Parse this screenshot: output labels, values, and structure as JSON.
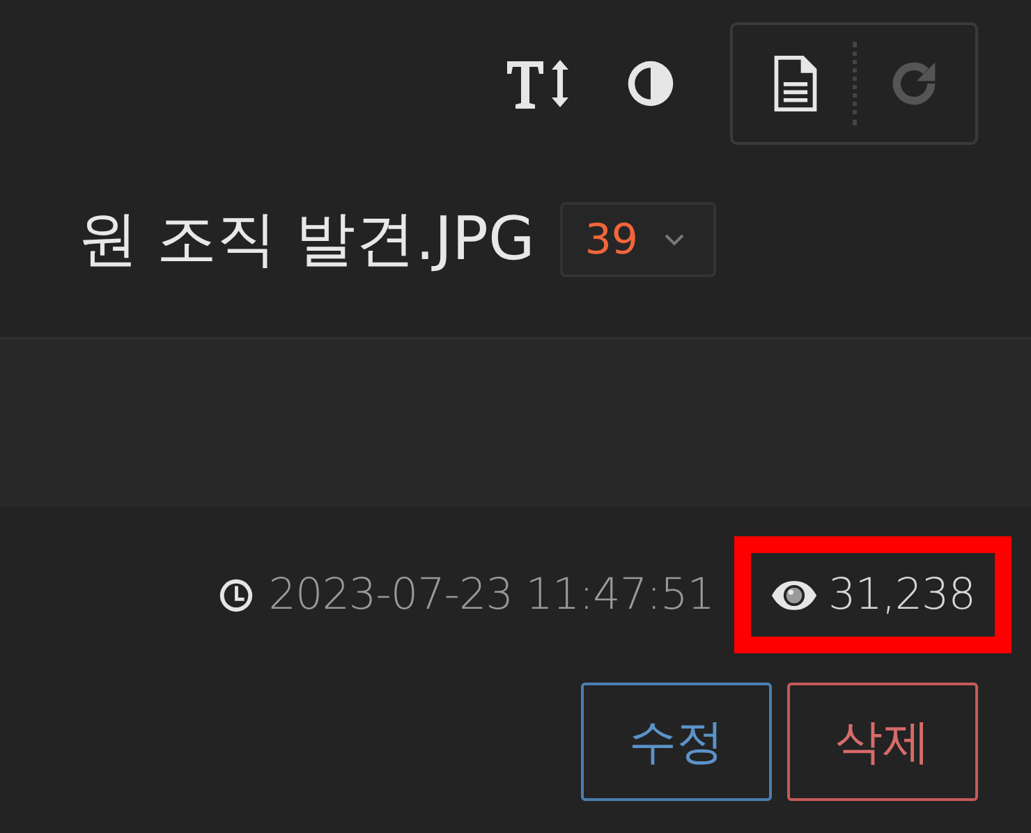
{
  "toolbar": {
    "tools": [
      {
        "kind": "text-size"
      },
      {
        "kind": "contrast"
      }
    ],
    "group": [
      {
        "kind": "document",
        "disabled": false
      },
      {
        "kind": "reload",
        "disabled": true
      }
    ]
  },
  "title": {
    "text": "원 조직 발견.JPG",
    "comment_count": "39"
  },
  "meta": {
    "datetime": "2023-07-23 11:47:51",
    "views": "31,238",
    "views_highlighted": true
  },
  "buttons": [
    {
      "label": "수정",
      "kind": "edit"
    },
    {
      "label": "삭제",
      "kind": "delete"
    }
  ]
}
